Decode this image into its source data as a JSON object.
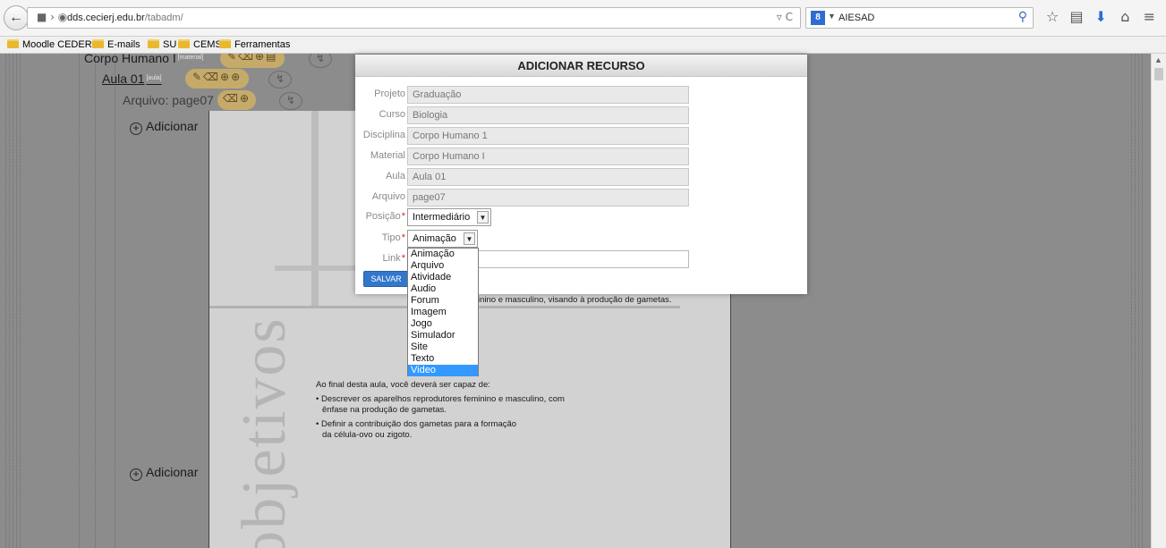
{
  "browser": {
    "url_host": "dds.cecierj.edu.br",
    "url_path": "/tabadm/",
    "search_engine": "8",
    "search_text": "AIESAD"
  },
  "bookmarks": [
    "Moodle CEDERJ",
    "E-mails",
    "SU",
    "CEMS",
    "Ferramentas"
  ],
  "tree": {
    "material_label": "Corpo Humano I",
    "material_tag": "[material]",
    "aula_label": "Aula 01",
    "aula_tag": "[aula]",
    "arquivo_label": "Arquivo: page07",
    "adicionar_label": "Adicionar"
  },
  "document": {
    "intro_text": "inino e masculino, visando à produção de gametas.",
    "objective_heading": "Ao final desta aula, você deverá ser capaz de:",
    "bullets": [
      "• Descrever os aparelhos reprodutores feminino e masculino, com",
      "ênfase na produção de gametas.",
      "• Definir a contribuição dos gametas para a formação",
      "da célula-ovo ou zigoto."
    ],
    "big_word": "objetivos"
  },
  "modal": {
    "title": "ADICIONAR RECURSO",
    "fields": [
      {
        "label": "Projeto",
        "value": "Graduação"
      },
      {
        "label": "Curso",
        "value": "Biologia"
      },
      {
        "label": "Disciplina",
        "value": "Corpo Humano 1"
      },
      {
        "label": "Material",
        "value": "Corpo Humano I"
      },
      {
        "label": "Aula",
        "value": "Aula 01"
      },
      {
        "label": "Arquivo",
        "value": "page07"
      }
    ],
    "posicao_label": "Posição",
    "posicao_value": "Intermediário",
    "tipo_label": "Tipo",
    "tipo_value": "Animação",
    "link_label": "Link",
    "required_mark": "*",
    "save_label": "SALVAR",
    "tipo_options": [
      "Animação",
      "Arquivo",
      "Atividade",
      "Audio",
      "Forum",
      "Imagem",
      "Jogo",
      "Simulador",
      "Site",
      "Texto",
      "Video"
    ],
    "tipo_highlighted": "Video"
  }
}
